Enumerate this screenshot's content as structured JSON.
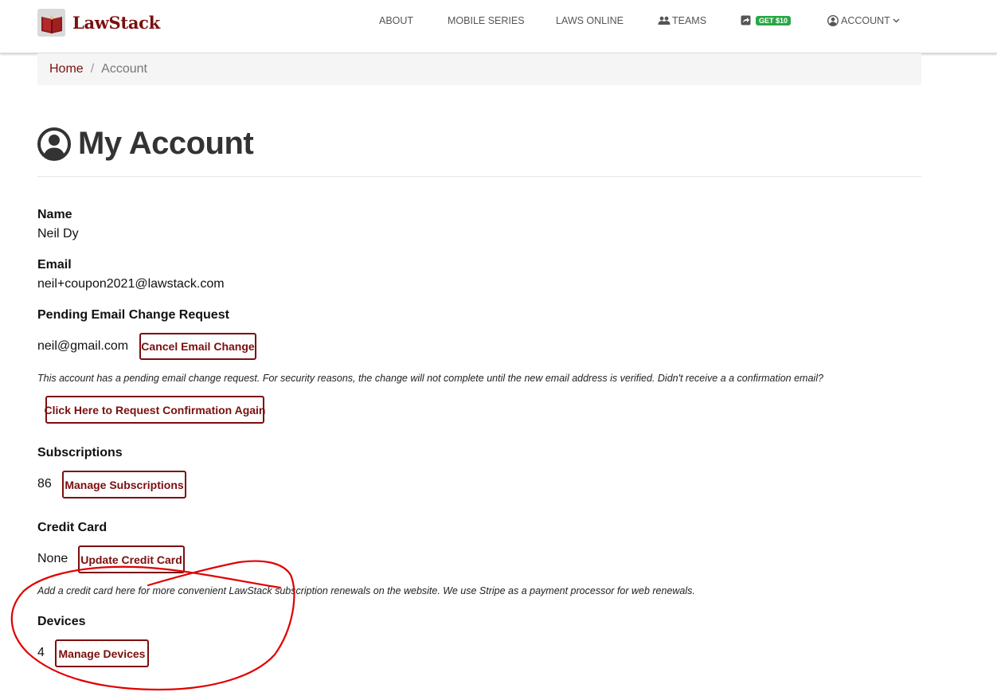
{
  "brand": {
    "name": "LawStack",
    "logo_icon": "book-icon"
  },
  "nav": {
    "about": "ABOUT",
    "mobile_series": "MOBILE SERIES",
    "laws_online": "LAWS ONLINE",
    "teams": "TEAMS",
    "get10": "GET $10",
    "account": "ACCOUNT"
  },
  "breadcrumb": {
    "home": "Home",
    "separator": "/",
    "current": "Account"
  },
  "page": {
    "title": "My Account"
  },
  "account": {
    "name_label": "Name",
    "name_value": "Neil Dy",
    "email_label": "Email",
    "email_value": "neil+coupon2021@lawstack.com",
    "pending_label": "Pending Email Change Request",
    "pending_value": "neil@gmail.com",
    "cancel_email_button": "Cancel Email Change",
    "pending_note": "This account has a pending email change request. For security reasons, the change will not complete until the new email address is verified. Didn't receive a a confirmation email?",
    "request_confirmation_button": "Click Here to Request Confirmation Again",
    "subscriptions_label": "Subscriptions",
    "subscriptions_value": "86",
    "manage_subscriptions_button": "Manage Subscriptions",
    "credit_card_label": "Credit Card",
    "credit_card_value": "None",
    "update_credit_card_button": "Update Credit Card",
    "credit_card_note": "Add a credit card here for more convenient LawStack subscription renewals on the website. We use Stripe as a payment processor for web renewals.",
    "devices_label": "Devices",
    "devices_value": "4",
    "manage_devices_button": "Manage Devices"
  },
  "colors": {
    "brand": "#7b0f0f",
    "badge": "#28a745",
    "annotation": "#e00000"
  }
}
